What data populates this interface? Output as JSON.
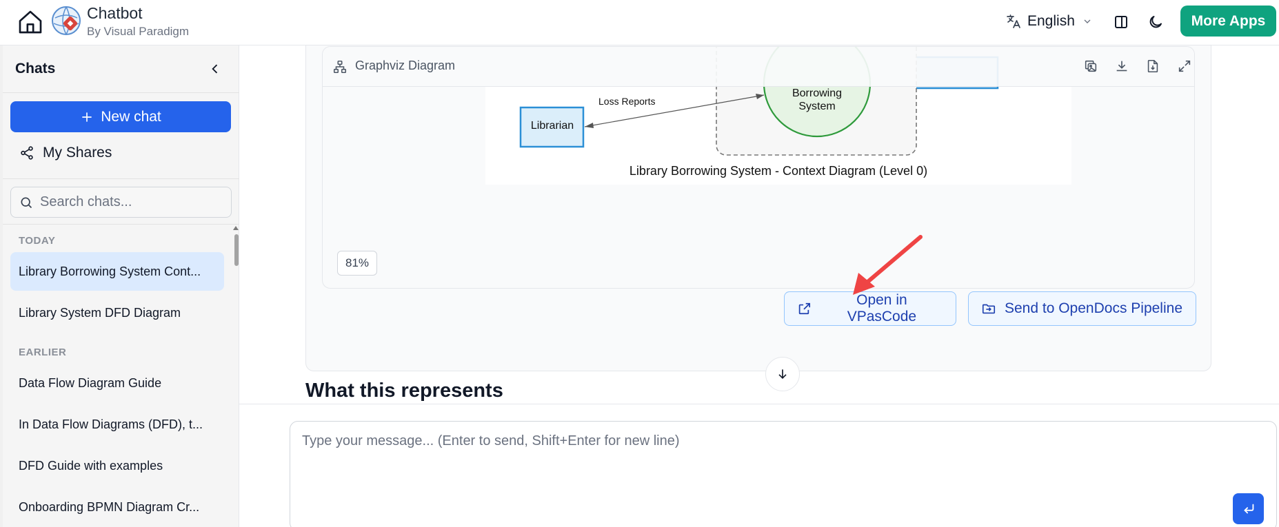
{
  "header": {
    "app_title": "Chatbot",
    "app_subtitle": "By Visual Paradigm",
    "language": "English",
    "more_apps_label": "More Apps"
  },
  "sidebar": {
    "title": "Chats",
    "new_chat_label": "New chat",
    "my_shares_label": "My Shares",
    "search_placeholder": "Search chats...",
    "sections": [
      {
        "label": "TODAY",
        "items": [
          "Library Borrowing System Cont...",
          "Library System DFD Diagram"
        ]
      },
      {
        "label": "EARLIER",
        "items": [
          "Data Flow Diagram Guide",
          "In Data Flow Diagrams (DFD), t...",
          "DFD Guide with examples",
          "Onboarding BPMN Diagram Cr..."
        ]
      }
    ],
    "active_item": "Library Borrowing System Cont..."
  },
  "diagram": {
    "toolbar_title": "Graphviz Diagram",
    "edge_label": "Loss Reports",
    "node_librarian": "Librarian",
    "process_line1": "Borrowing",
    "process_line2": "System",
    "caption": "Library Borrowing System - Context Diagram (Level 0)",
    "zoom": "81%",
    "colors": {
      "external_entity_fill": "#dbeefa",
      "external_entity_stroke": "#2b8fd6",
      "process_fill": "#e6f4e4",
      "process_stroke": "#2e9a3b",
      "boundary_stroke": "#777777"
    }
  },
  "actions": {
    "open_vpascode": "Open in VPasCode",
    "send_opendocs": "Send to OpenDocs Pipeline"
  },
  "content": {
    "section_title": "What this represents"
  },
  "composer": {
    "placeholder": "Type your message... (Enter to send, Shift+Enter for new line)"
  },
  "accent_colors": {
    "primary_blue": "#2563eb",
    "green_button": "#0fa37f",
    "annotation_arrow": "#ef4444"
  }
}
